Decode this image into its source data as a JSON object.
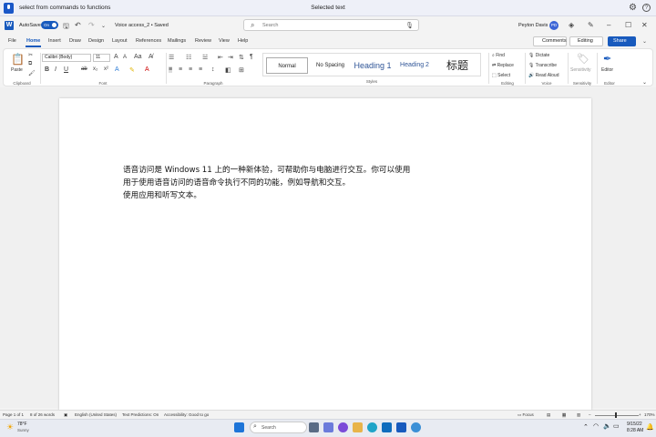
{
  "voice_access": {
    "command": "select from commands to functions",
    "status": "Selected text"
  },
  "titlebar": {
    "autosave": "AutoSave",
    "autosave_state": "On",
    "filename": "Voice access_2 • Saved",
    "search_placeholder": "Search",
    "user": "Peyton Davis",
    "avatar_initials": "PD"
  },
  "menu": {
    "tabs": [
      "File",
      "Home",
      "Insert",
      "Draw",
      "Design",
      "Layout",
      "References",
      "Mailings",
      "Review",
      "View",
      "Help"
    ],
    "active_index": 1,
    "comments": "Comments",
    "editing": "Editing",
    "share": "Share"
  },
  "ribbon": {
    "clipboard": {
      "paste": "Paste",
      "label": "Clipboard"
    },
    "font": {
      "name": "Calibri (Body)",
      "size": "11",
      "label": "Font"
    },
    "paragraph": {
      "label": "Paragraph"
    },
    "styles": {
      "items": [
        "Normal",
        "No Spacing",
        "Heading 1",
        "Heading 2",
        "标题"
      ],
      "label": "Styles"
    },
    "editing": {
      "find": "Find",
      "replace": "Replace",
      "select": "Select",
      "label": "Editing"
    },
    "voice": {
      "dictate": "Dictate",
      "transcribe": "Transcribe",
      "read_aloud": "Read Aloud",
      "label": "Voice"
    },
    "sensitivity": {
      "button": "Sensitivity",
      "label": "Sensitivity"
    },
    "editor": {
      "button": "Editor",
      "label": "Editor"
    }
  },
  "document": {
    "lines": [
      "语音访问是 Windows 11 上的一种新体验，可帮助你与电脑进行交互。你可以使用",
      "用于使用语音访问的语音命令执行不同的功能，例如导航和交互。",
      "使用应用和听写文本。"
    ]
  },
  "status_bar": {
    "page": "Page 1 of 1",
    "words": "8 of 26 words",
    "language": "English (United States)",
    "predictions": "Text Predictions: On",
    "accessibility": "Accessibility: Good to go",
    "focus": "Focus",
    "zoom": "170%"
  },
  "taskbar": {
    "weather_temp": "78°F",
    "weather_desc": "Sunny",
    "search": "Search",
    "date": "9/15/22",
    "time": "8:28 AM"
  },
  "colors": {
    "accent": "#185abd"
  }
}
